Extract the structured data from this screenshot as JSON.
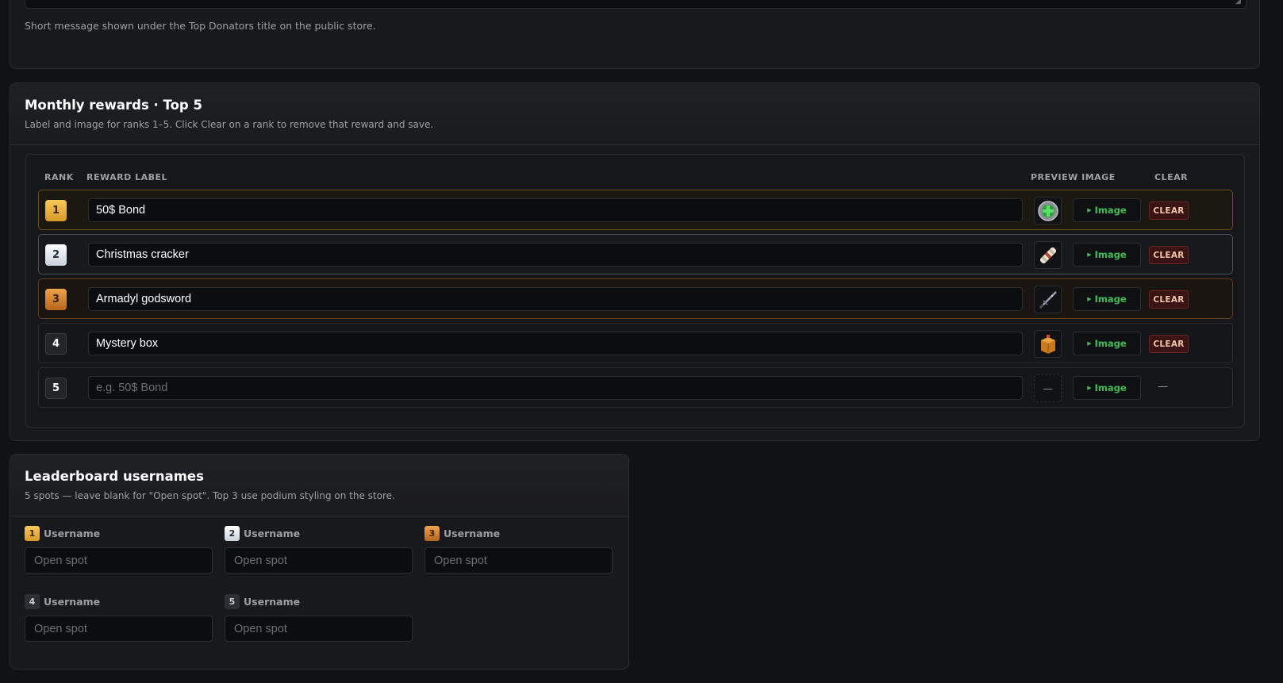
{
  "top_card": {
    "hint": "Short message shown under the Top Donators title on the public store."
  },
  "rewards": {
    "title": "Monthly rewards · Top 5",
    "subtitle": "Label and image for ranks 1–5. Click Clear on a rank to remove that reward and save.",
    "columns": {
      "rank": "RANK",
      "label": "REWARD LABEL",
      "preview": "PREVIEW IMAGE",
      "clear": "CLEAR"
    },
    "image_button_label": "Image",
    "clear_button_label": "CLEAR",
    "empty_marker": "—",
    "placeholder": "e.g. 50$ Bond",
    "rows": [
      {
        "rank": "1",
        "label": "50$ Bond",
        "icon": "bond-icon"
      },
      {
        "rank": "2",
        "label": "Christmas cracker",
        "icon": "cracker-icon"
      },
      {
        "rank": "3",
        "label": "Armadyl godsword",
        "icon": "godsword-icon"
      },
      {
        "rank": "4",
        "label": "Mystery box",
        "icon": "mystery-box-icon"
      },
      {
        "rank": "5",
        "label": "",
        "icon": ""
      }
    ]
  },
  "leaderboard": {
    "title": "Leaderboard usernames",
    "subtitle": "5 spots — leave blank for \"Open spot\". Top 3 use podium styling on the store.",
    "slots": [
      {
        "rank": "1",
        "label": "Username",
        "placeholder": "Open spot",
        "value": ""
      },
      {
        "rank": "2",
        "label": "Username",
        "placeholder": "Open spot",
        "value": ""
      },
      {
        "rank": "3",
        "label": "Username",
        "placeholder": "Open spot",
        "value": ""
      },
      {
        "rank": "4",
        "label": "Username",
        "placeholder": "Open spot",
        "value": ""
      },
      {
        "rank": "5",
        "label": "Username",
        "placeholder": "Open spot",
        "value": ""
      }
    ]
  },
  "colors": {
    "background": "#111214",
    "card": "#18191c",
    "gold": "#f0b840",
    "silver": "#e8eef3",
    "bronze": "#d8862e",
    "image_button_text": "#3fbf5a",
    "clear_button_bg": "#3a1414"
  }
}
